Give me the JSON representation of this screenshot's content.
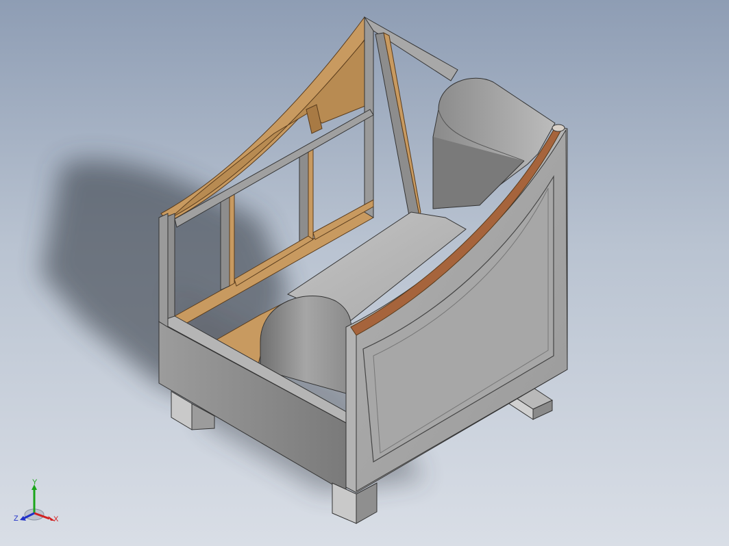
{
  "viewport": {
    "model_name": "armchair-frame-assembly",
    "view_orientation": "isometric",
    "colors": {
      "bg_top": "#8e9db4",
      "bg_bottom": "#d9dee6",
      "wood": "#c89a60",
      "gray_body": "#a4a4a4",
      "cushion": "#9a9a9a",
      "shadow": "#3a3f47"
    }
  },
  "triad": {
    "x_label": "X",
    "y_label": "Y",
    "z_label": "Z",
    "x_color": "#d22020",
    "y_color": "#1aa51a",
    "z_color": "#2030c8"
  }
}
